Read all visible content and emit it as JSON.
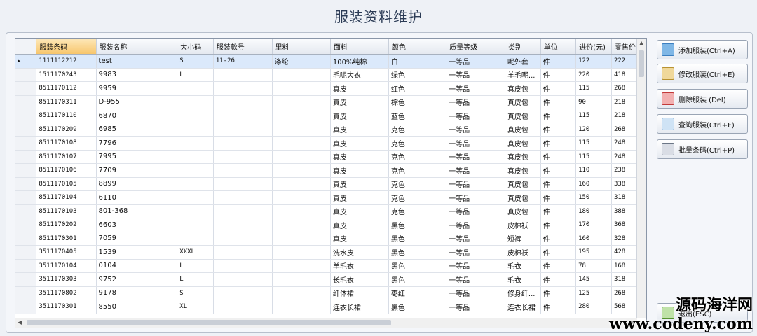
{
  "window": {
    "title": "服装资料维护"
  },
  "table": {
    "columns": [
      "服装条码",
      "服装名称",
      "大小码",
      "服装款号",
      "里料",
      "面料",
      "颜色",
      "质量等级",
      "类别",
      "单位",
      "进价(元)",
      "零售价"
    ],
    "rows": [
      [
        "1111112212",
        "test",
        "S",
        "11-26",
        "涤纶",
        "100%纯棉",
        "白",
        "一等品",
        "呢外套",
        "件",
        "122",
        "222"
      ],
      [
        "1511170243",
        "9983",
        "L",
        "",
        "",
        "毛呢大衣",
        "绿色",
        "一等品",
        "羊毛呢...",
        "件",
        "220",
        "418"
      ],
      [
        "8511170112",
        "9959",
        "",
        "",
        "",
        "真皮",
        "红色",
        "一等品",
        "真皮包",
        "件",
        "115",
        "268"
      ],
      [
        "8511170311",
        "D-955",
        "",
        "",
        "",
        "真皮",
        "棕色",
        "一等品",
        "真皮包",
        "件",
        "90",
        "218"
      ],
      [
        "8511170110",
        "6870",
        "",
        "",
        "",
        "真皮",
        "蓝色",
        "一等品",
        "真皮包",
        "件",
        "115",
        "218"
      ],
      [
        "8511170209",
        "6985",
        "",
        "",
        "",
        "真皮",
        "克色",
        "一等品",
        "真皮包",
        "件",
        "120",
        "268"
      ],
      [
        "8511170108",
        "7796",
        "",
        "",
        "",
        "真皮",
        "克色",
        "一等品",
        "真皮包",
        "件",
        "115",
        "248"
      ],
      [
        "8511170107",
        "7995",
        "",
        "",
        "",
        "真皮",
        "克色",
        "一等品",
        "真皮包",
        "件",
        "115",
        "248"
      ],
      [
        "8511170106",
        "7709",
        "",
        "",
        "",
        "真皮",
        "克色",
        "一等品",
        "真皮包",
        "件",
        "110",
        "238"
      ],
      [
        "8511170105",
        "8899",
        "",
        "",
        "",
        "真皮",
        "克色",
        "一等品",
        "真皮包",
        "件",
        "160",
        "338"
      ],
      [
        "8511170104",
        "6110",
        "",
        "",
        "",
        "真皮",
        "克色",
        "一等品",
        "真皮包",
        "件",
        "150",
        "318"
      ],
      [
        "8511170103",
        "801-368",
        "",
        "",
        "",
        "真皮",
        "克色",
        "一等品",
        "真皮包",
        "件",
        "180",
        "388"
      ],
      [
        "8511170202",
        "6603",
        "",
        "",
        "",
        "真皮",
        "黑色",
        "一等品",
        "皮棉袄",
        "件",
        "170",
        "368"
      ],
      [
        "8511170301",
        "7059",
        "",
        "",
        "",
        "真皮",
        "黑色",
        "一等品",
        "短裤",
        "件",
        "160",
        "328"
      ],
      [
        "3511170405",
        "1539",
        "XXXL",
        "",
        "",
        "洗水皮",
        "黑色",
        "一等品",
        "皮棉袄",
        "件",
        "195",
        "428"
      ],
      [
        "3511170104",
        "0104",
        "L",
        "",
        "",
        "羊毛衣",
        "黑色",
        "一等品",
        "毛衣",
        "件",
        "78",
        "168"
      ],
      [
        "3511170303",
        "9752",
        "L",
        "",
        "",
        "长毛衣",
        "黑色",
        "一等品",
        "毛衣",
        "件",
        "145",
        "318"
      ],
      [
        "3511170802",
        "9178",
        "S",
        "",
        "",
        "纤体裙",
        "枣红",
        "一等品",
        "修身纤...",
        "件",
        "125",
        "268"
      ],
      [
        "3511170301",
        "8550",
        "XL",
        "",
        "",
        "连衣长裙",
        "黑色",
        "一等品",
        "连衣长裙",
        "件",
        "280",
        "568"
      ]
    ]
  },
  "buttons": {
    "add": "添加服装(Ctrl+A)",
    "edit": "修改服装(Ctrl+E)",
    "delete": "删除服装    (Del)",
    "query": "查询服装(Ctrl+F)",
    "barcode": "批量条码(Ctrl+P)",
    "exit": "退出(ESC)"
  },
  "watermark": {
    "line1": "源码海洋网",
    "line2": "www.codeny.com"
  }
}
